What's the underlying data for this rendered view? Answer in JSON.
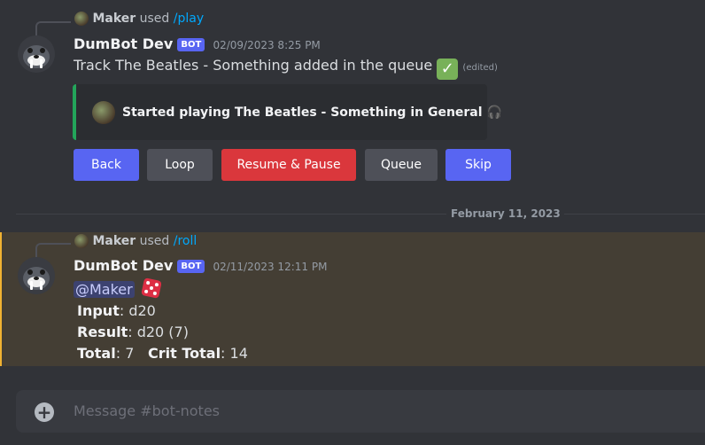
{
  "messages": [
    {
      "reply": {
        "user": "Maker",
        "used": "used",
        "command": "/play"
      },
      "author": "DumBot Dev",
      "badge": "BOT",
      "timestamp": "02/09/2023 8:25 PM",
      "content": "Track The Beatles - Something added in the queue",
      "edited": "(edited)",
      "embed": {
        "title": "Started playing The Beatles - Something in General",
        "headphones": "🎧"
      },
      "buttons": [
        "Back",
        "Loop",
        "Resume & Pause",
        "Queue",
        "Skip"
      ]
    },
    {
      "reply": {
        "user": "Maker",
        "used": "used",
        "command": "/roll"
      },
      "author": "DumBot Dev",
      "badge": "BOT",
      "timestamp": "02/11/2023 12:11 PM",
      "mention": "@Maker",
      "fields": {
        "input_label": "Input",
        "input_value": ": d20",
        "result_label": "Result",
        "result_value": ": d20 (7)",
        "total_label": "Total",
        "total_value": ": 7",
        "crit_label": "Crit Total",
        "crit_value": ": 14"
      }
    }
  ],
  "date_divider": "February 11, 2023",
  "composer": {
    "placeholder": "Message #bot-notes"
  },
  "colors": {
    "primary": "#5865f2",
    "secondary": "#4e5058",
    "danger": "#da373c",
    "embed_accent": "#23a55a",
    "highlight_accent": "#f0b232"
  }
}
